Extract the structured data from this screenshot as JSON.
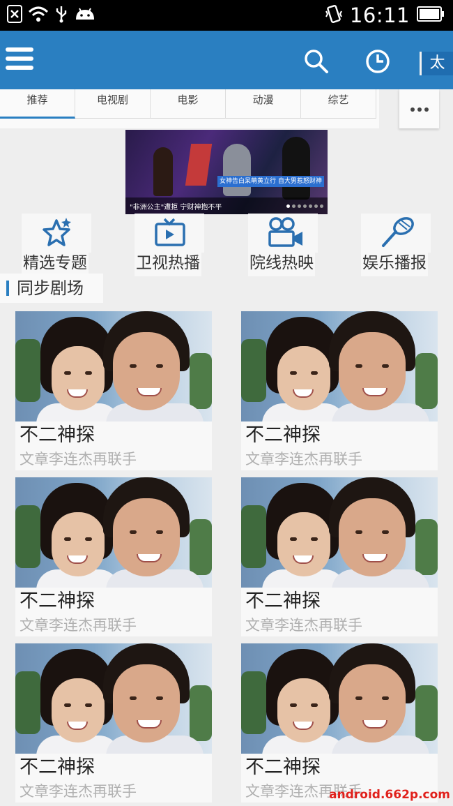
{
  "status_bar": {
    "time": "16:11",
    "icons": [
      "no-sim-icon",
      "wifi-icon",
      "usb-icon",
      "android-icon",
      "vibrate-icon",
      "battery-icon"
    ]
  },
  "header": {
    "icons": [
      "menu-icon",
      "search-icon",
      "history-icon"
    ],
    "tv_button_label": "太",
    "bg_color": "#2a7fc1"
  },
  "tabs": [
    {
      "label": "推荐",
      "active": true
    },
    {
      "label": "电视剧",
      "active": false
    },
    {
      "label": "电影",
      "active": false
    },
    {
      "label": "动漫",
      "active": false
    },
    {
      "label": "综艺",
      "active": false
    }
  ],
  "more_tabs": {
    "icon": "more-dots-icon"
  },
  "banner": {
    "caption": "\"非洲公主\"遭拒 宁财神抱不平",
    "overlay_tag": "女神告白呆萌黄立行 自大男惹怒财神",
    "slide_count": 7,
    "active_slide": 1
  },
  "categories": [
    {
      "label": "精选专题",
      "icon": "star-icon"
    },
    {
      "label": "卫视热播",
      "icon": "tv-icon"
    },
    {
      "label": "院线热映",
      "icon": "movie-camera-icon"
    },
    {
      "label": "娱乐播报",
      "icon": "microphone-icon"
    }
  ],
  "section": {
    "title": "同步剧场"
  },
  "cards": [
    {
      "title": "不二神探",
      "subtitle": "文章李连杰再联手"
    },
    {
      "title": "不二神探",
      "subtitle": "文章李连杰再联手"
    },
    {
      "title": "不二神探",
      "subtitle": "文章李连杰再联手"
    },
    {
      "title": "不二神探",
      "subtitle": "文章李连杰再联手"
    },
    {
      "title": "不二神探",
      "subtitle": "文章李连杰再联手"
    },
    {
      "title": "不二神探",
      "subtitle": "文章李连杰再联手"
    }
  ],
  "watermark": "android.662p.com"
}
